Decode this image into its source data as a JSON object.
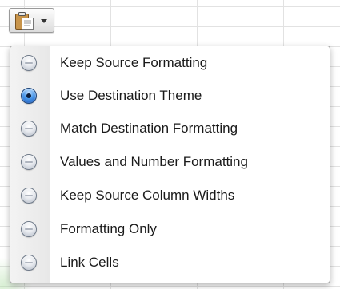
{
  "paste_options": {
    "icon": "clipboard-paste-icon",
    "arrow_icon": "chevron-down-icon"
  },
  "menu": {
    "items": [
      {
        "label": "Keep Source Formatting",
        "selected": false
      },
      {
        "label": "Use Destination Theme",
        "selected": true
      },
      {
        "label": "Match Destination Formatting",
        "selected": false
      },
      {
        "label": "Values and Number Formatting",
        "selected": false
      },
      {
        "label": "Keep Source Column Widths",
        "selected": false
      },
      {
        "label": "Formatting Only",
        "selected": false
      },
      {
        "label": "Link Cells",
        "selected": false
      }
    ]
  },
  "colors": {
    "selected_radio": "#2a74d6",
    "unselected_radio": "#c3c9d2",
    "text": "#1a1a1a"
  }
}
